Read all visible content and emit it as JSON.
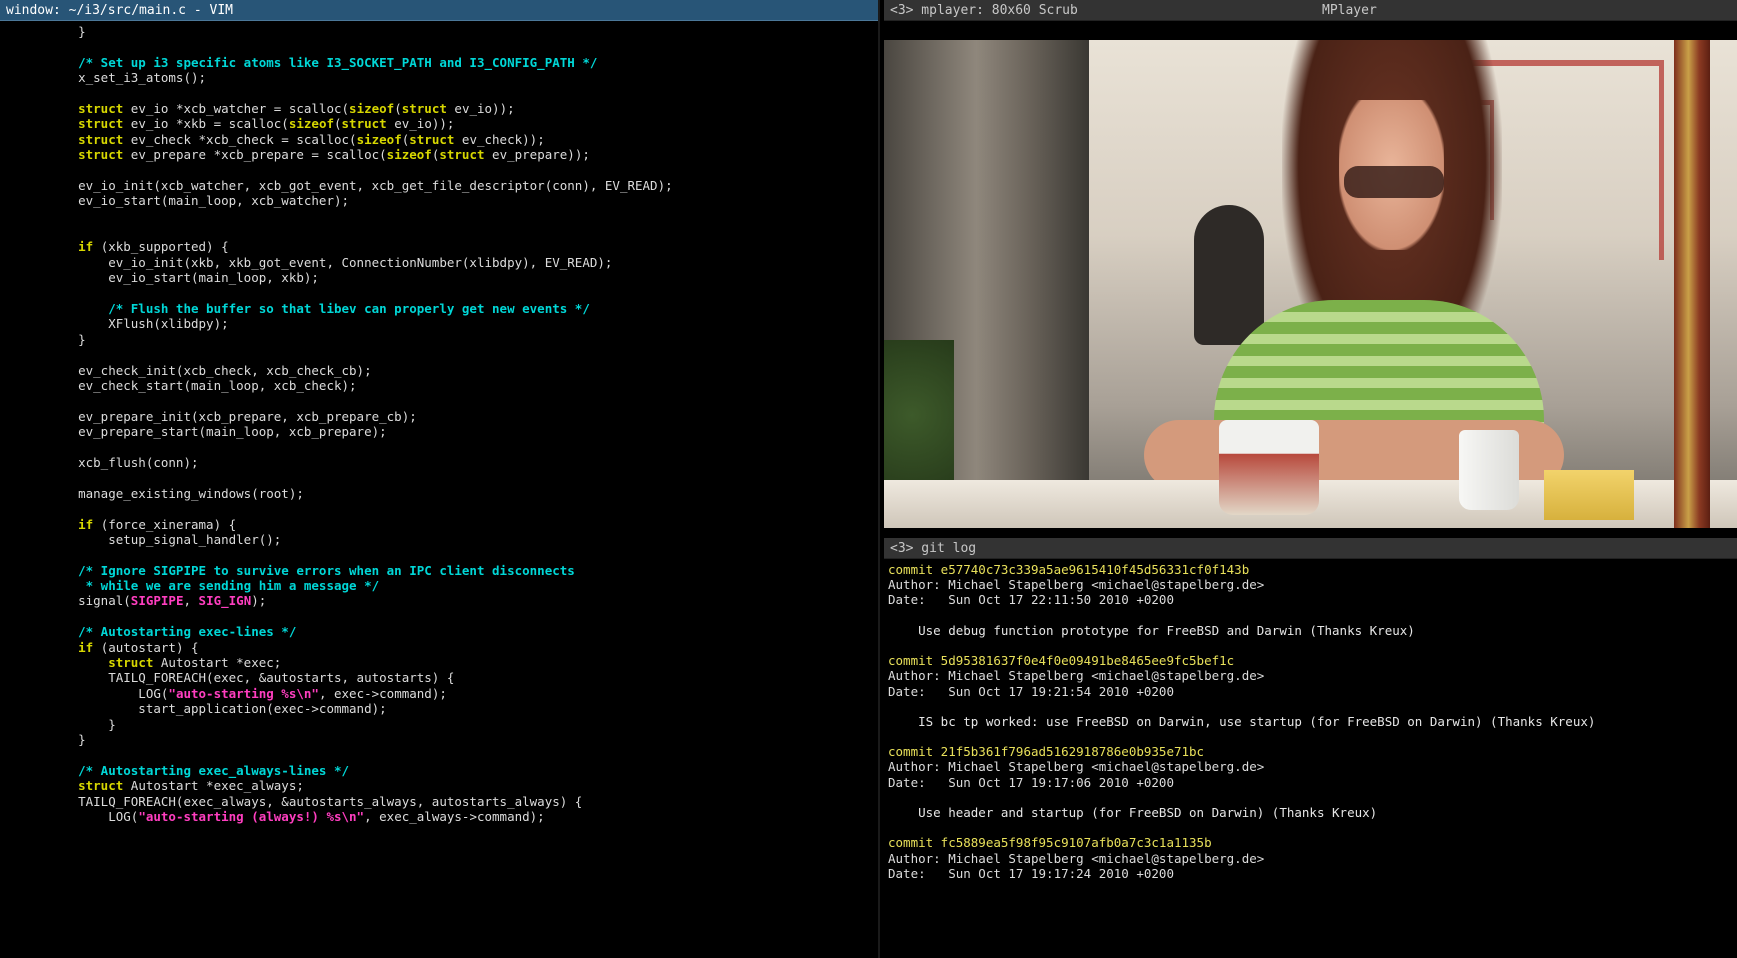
{
  "vim": {
    "title": "window: ~/i3/src/main.c - VIM",
    "lines": [
      {
        "segments": [
          {
            "t": "    }",
            "c": "text"
          }
        ]
      },
      {
        "segments": []
      },
      {
        "segments": [
          {
            "t": "    /* Set up i3 specific atoms like I3_SOCKET_PATH and I3_CONFIG_PATH */",
            "c": "comment"
          }
        ]
      },
      {
        "segments": [
          {
            "t": "    x_set_i3_atoms();",
            "c": "text"
          }
        ]
      },
      {
        "segments": []
      },
      {
        "segments": [
          {
            "t": "    struct ev_io *xcb_watcher = scalloc(sizeof(struct ev_io));",
            "c": "mixed-struct"
          }
        ]
      },
      {
        "segments": [
          {
            "t": "    struct ev_io *xkb = scalloc(sizeof(struct ev_io));",
            "c": "mixed-struct"
          }
        ]
      },
      {
        "segments": [
          {
            "t": "    struct ev_check *xcb_check = scalloc(sizeof(struct ev_check));",
            "c": "mixed-struct"
          }
        ]
      },
      {
        "segments": [
          {
            "t": "    struct ev_prepare *xcb_prepare = scalloc(sizeof(struct ev_prepare));",
            "c": "mixed-struct"
          }
        ]
      },
      {
        "segments": []
      },
      {
        "segments": [
          {
            "t": "    ev_io_init(xcb_watcher, xcb_got_event, xcb_get_file_descriptor(conn), EV_READ);",
            "c": "text"
          }
        ]
      },
      {
        "segments": [
          {
            "t": "    ev_io_start(main_loop, xcb_watcher);",
            "c": "text"
          }
        ]
      },
      {
        "segments": []
      },
      {
        "segments": []
      },
      {
        "segments": [
          {
            "t": "    if (xkb_supported) {",
            "c": "mixed-if"
          }
        ]
      },
      {
        "segments": [
          {
            "t": "        ev_io_init(xkb, xkb_got_event, ConnectionNumber(xlibdpy), EV_READ);",
            "c": "text"
          }
        ]
      },
      {
        "segments": [
          {
            "t": "        ev_io_start(main_loop, xkb);",
            "c": "text"
          }
        ]
      },
      {
        "segments": []
      },
      {
        "segments": [
          {
            "t": "        /* Flush the buffer so that libev can properly get new events */",
            "c": "comment"
          }
        ]
      },
      {
        "segments": [
          {
            "t": "        XFlush(xlibdpy);",
            "c": "text"
          }
        ]
      },
      {
        "segments": [
          {
            "t": "    }",
            "c": "text"
          }
        ]
      },
      {
        "segments": []
      },
      {
        "segments": [
          {
            "t": "    ev_check_init(xcb_check, xcb_check_cb);",
            "c": "text"
          }
        ]
      },
      {
        "segments": [
          {
            "t": "    ev_check_start(main_loop, xcb_check);",
            "c": "text"
          }
        ]
      },
      {
        "segments": []
      },
      {
        "segments": [
          {
            "t": "    ev_prepare_init(xcb_prepare, xcb_prepare_cb);",
            "c": "text"
          }
        ]
      },
      {
        "segments": [
          {
            "t": "    ev_prepare_start(main_loop, xcb_prepare);",
            "c": "text"
          }
        ]
      },
      {
        "segments": []
      },
      {
        "segments": [
          {
            "t": "    xcb_flush(conn);",
            "c": "text"
          }
        ]
      },
      {
        "segments": []
      },
      {
        "segments": [
          {
            "t": "    manage_existing_windows(root);",
            "c": "text"
          }
        ]
      },
      {
        "segments": []
      },
      {
        "segments": [
          {
            "t": "    if (force_xinerama) {",
            "c": "mixed-if"
          }
        ]
      },
      {
        "segments": [
          {
            "t": "        setup_signal_handler();",
            "c": "text"
          }
        ]
      },
      {
        "segments": []
      },
      {
        "segments": [
          {
            "t": "    /* Ignore SIGPIPE to survive errors when an IPC client disconnects",
            "c": "comment"
          }
        ]
      },
      {
        "segments": [
          {
            "t": "     * while we are sending him a message */",
            "c": "comment"
          }
        ]
      },
      {
        "segments": [
          {
            "t": "    signal(SIGPIPE, SIG_IGN);",
            "c": "mixed-signal"
          }
        ]
      },
      {
        "segments": []
      },
      {
        "segments": [
          {
            "t": "    /* Autostarting exec-lines */",
            "c": "comment"
          }
        ]
      },
      {
        "segments": [
          {
            "t": "    if (autostart) {",
            "c": "mixed-if"
          }
        ]
      },
      {
        "segments": [
          {
            "t": "        struct Autostart *exec;",
            "c": "mixed-struct-cursor"
          }
        ]
      },
      {
        "segments": [
          {
            "t": "        TAILQ_FOREACH(exec, &autostarts, autostarts) {",
            "c": "text"
          }
        ]
      },
      {
        "segments": [
          {
            "t": "            LOG(\"auto-starting %s\\n\", exec->command);",
            "c": "mixed-log"
          }
        ]
      },
      {
        "segments": [
          {
            "t": "            start_application(exec->command);",
            "c": "text"
          }
        ]
      },
      {
        "segments": [
          {
            "t": "        }",
            "c": "text"
          }
        ]
      },
      {
        "segments": [
          {
            "t": "    }",
            "c": "text"
          }
        ]
      },
      {
        "segments": []
      },
      {
        "segments": [
          {
            "t": "    /* Autostarting exec_always-lines */",
            "c": "comment"
          }
        ]
      },
      {
        "segments": [
          {
            "t": "    struct Autostart *exec_always;",
            "c": "mixed-struct"
          }
        ]
      },
      {
        "segments": [
          {
            "t": "    TAILQ_FOREACH(exec_always, &autostarts_always, autostarts_always) {",
            "c": "text"
          }
        ]
      },
      {
        "segments": [
          {
            "t": "        LOG(\"auto-starting (always!) %s\\n\", exec_always->command);",
            "c": "mixed-log"
          }
        ]
      }
    ]
  },
  "player": {
    "title_left": "<3> mplayer: 80x60 Scrub",
    "title_right": "MPlayer"
  },
  "term": {
    "title": "<3> git log",
    "entries": [
      {
        "commit": "commit e57740c73c339a5ae9615410f45d56331cf0f143b",
        "author": "Author: Michael Stapelberg <michael@stapelberg.de>",
        "date": "Date:   Sun Oct 17 22:11:50 2010 +0200",
        "message": "    Use debug function prototype for FreeBSD and Darwin (Thanks Kreux)"
      },
      {
        "commit": "commit 5d95381637f0e4f0e09491be8465ee9fc5bef1c",
        "author": "Author: Michael Stapelberg <michael@stapelberg.de>",
        "date": "Date:   Sun Oct 17 19:21:54 2010 +0200",
        "message": "    IS bc tp worked: use FreeBSD on Darwin, use startup (for FreeBSD on Darwin) (Thanks Kreux)"
      },
      {
        "commit": "commit 21f5b361f796ad5162918786e0b935e71bc",
        "author": "Author: Michael Stapelberg <michael@stapelberg.de>",
        "date": "Date:   Sun Oct 17 19:17:06 2010 +0200",
        "message": "    Use header and startup (for FreeBSD on Darwin) (Thanks Kreux)"
      },
      {
        "commit": "commit fc5889ea5f98f95c9107afb0a7c3c1a1135b",
        "author": "Author: Michael Stapelberg <michael@stapelberg.de>",
        "date": "Date:   Sun Oct 17 19:17:24 2010 +0200",
        "message": ""
      }
    ]
  }
}
